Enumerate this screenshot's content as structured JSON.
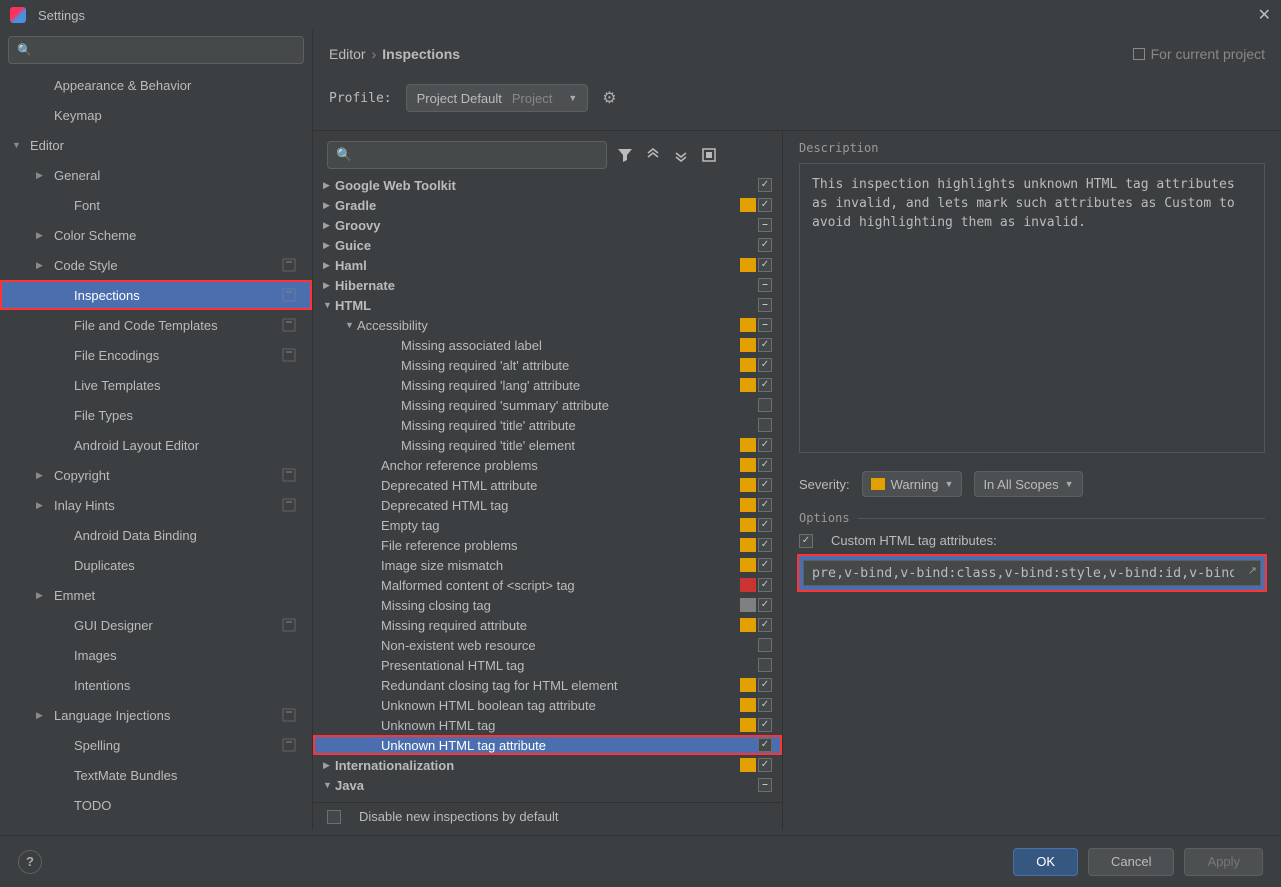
{
  "window_title": "Settings",
  "breadcrumb": {
    "a": "Editor",
    "b": "Inspections",
    "proj": "For current project"
  },
  "profile": {
    "label": "Profile:",
    "name": "Project Default",
    "scope": "Project"
  },
  "sidebar": {
    "items": [
      {
        "label": "Appearance & Behavior",
        "depth": 1,
        "arrow": false
      },
      {
        "label": "Keymap",
        "depth": 1,
        "arrow": false
      },
      {
        "label": "Editor",
        "depth": 0,
        "arrow": true,
        "open": true
      },
      {
        "label": "General",
        "depth": 1,
        "arrow": true
      },
      {
        "label": "Font",
        "depth": 2,
        "arrow": false
      },
      {
        "label": "Color Scheme",
        "depth": 1,
        "arrow": true
      },
      {
        "label": "Code Style",
        "depth": 1,
        "arrow": true,
        "proj": true
      },
      {
        "label": "Inspections",
        "depth": 2,
        "arrow": false,
        "selected": true,
        "proj": true,
        "hl": true
      },
      {
        "label": "File and Code Templates",
        "depth": 2,
        "arrow": false,
        "proj": true
      },
      {
        "label": "File Encodings",
        "depth": 2,
        "arrow": false,
        "proj": true
      },
      {
        "label": "Live Templates",
        "depth": 2,
        "arrow": false
      },
      {
        "label": "File Types",
        "depth": 2,
        "arrow": false
      },
      {
        "label": "Android Layout Editor",
        "depth": 2,
        "arrow": false
      },
      {
        "label": "Copyright",
        "depth": 1,
        "arrow": true,
        "proj": true
      },
      {
        "label": "Inlay Hints",
        "depth": 1,
        "arrow": true,
        "proj": true
      },
      {
        "label": "Android Data Binding",
        "depth": 2,
        "arrow": false
      },
      {
        "label": "Duplicates",
        "depth": 2,
        "arrow": false
      },
      {
        "label": "Emmet",
        "depth": 1,
        "arrow": true
      },
      {
        "label": "GUI Designer",
        "depth": 2,
        "arrow": false,
        "proj": true
      },
      {
        "label": "Images",
        "depth": 2,
        "arrow": false
      },
      {
        "label": "Intentions",
        "depth": 2,
        "arrow": false
      },
      {
        "label": "Language Injections",
        "depth": 1,
        "arrow": true,
        "proj": true
      },
      {
        "label": "Spelling",
        "depth": 2,
        "arrow": false,
        "proj": true
      },
      {
        "label": "TextMate Bundles",
        "depth": 2,
        "arrow": false
      },
      {
        "label": "TODO",
        "depth": 2,
        "arrow": false
      }
    ]
  },
  "tree": [
    {
      "label": "Google Web Toolkit",
      "depth": 0,
      "arrow": "r",
      "cb": "checked"
    },
    {
      "label": "Gradle",
      "depth": 0,
      "arrow": "r",
      "sev": "yellow",
      "cb": "checked"
    },
    {
      "label": "Groovy",
      "depth": 0,
      "arrow": "r",
      "cb": "mixed"
    },
    {
      "label": "Guice",
      "depth": 0,
      "arrow": "r",
      "cb": "checked"
    },
    {
      "label": "Haml",
      "depth": 0,
      "arrow": "r",
      "sev": "yellow",
      "cb": "checked"
    },
    {
      "label": "Hibernate",
      "depth": 0,
      "arrow": "r",
      "cb": "mixed"
    },
    {
      "label": "HTML",
      "depth": 0,
      "arrow": "d",
      "cb": "mixed"
    },
    {
      "label": "Accessibility",
      "depth": 1,
      "arrow": "d",
      "sev": "yellow",
      "cb": "mixed"
    },
    {
      "label": "Missing associated label",
      "depth": 3,
      "sev": "yellow",
      "cb": "checked"
    },
    {
      "label": "Missing required 'alt' attribute",
      "depth": 3,
      "sev": "yellow",
      "cb": "checked"
    },
    {
      "label": "Missing required 'lang' attribute",
      "depth": 3,
      "sev": "yellow",
      "cb": "checked"
    },
    {
      "label": "Missing required 'summary' attribute",
      "depth": 3,
      "cb": ""
    },
    {
      "label": "Missing required 'title' attribute",
      "depth": 3,
      "cb": ""
    },
    {
      "label": "Missing required 'title' element",
      "depth": 3,
      "sev": "yellow",
      "cb": "checked"
    },
    {
      "label": "Anchor reference problems",
      "depth": 2,
      "sev": "yellow",
      "cb": "checked"
    },
    {
      "label": "Deprecated HTML attribute",
      "depth": 2,
      "sev": "yellow",
      "cb": "checked"
    },
    {
      "label": "Deprecated HTML tag",
      "depth": 2,
      "sev": "yellow",
      "cb": "checked"
    },
    {
      "label": "Empty tag",
      "depth": 2,
      "sev": "yellow",
      "cb": "checked"
    },
    {
      "label": "File reference problems",
      "depth": 2,
      "sev": "yellow",
      "cb": "checked"
    },
    {
      "label": "Image size mismatch",
      "depth": 2,
      "sev": "yellow",
      "cb": "checked"
    },
    {
      "label": "Malformed content of <script> tag",
      "depth": 2,
      "sev": "red",
      "cb": "checked"
    },
    {
      "label": "Missing closing tag",
      "depth": 2,
      "sev": "gray",
      "cb": "checked"
    },
    {
      "label": "Missing required attribute",
      "depth": 2,
      "sev": "yellow",
      "cb": "checked"
    },
    {
      "label": "Non-existent web resource",
      "depth": 2,
      "cb": ""
    },
    {
      "label": "Presentational HTML tag",
      "depth": 2,
      "cb": ""
    },
    {
      "label": "Redundant closing tag for HTML element",
      "depth": 2,
      "sev": "yellow",
      "cb": "checked"
    },
    {
      "label": "Unknown HTML boolean tag attribute",
      "depth": 2,
      "sev": "yellow",
      "cb": "checked"
    },
    {
      "label": "Unknown HTML tag",
      "depth": 2,
      "sev": "yellow",
      "cb": "checked"
    },
    {
      "label": "Unknown HTML tag attribute",
      "depth": 2,
      "selected": true,
      "hl": true,
      "cb": "checked"
    },
    {
      "label": "Internationalization",
      "depth": 0,
      "arrow": "r",
      "sev": "yellow",
      "cb": "checked"
    },
    {
      "label": "Java",
      "depth": 0,
      "arrow": "d",
      "cb": "mixed"
    }
  ],
  "disable_new": "Disable new inspections by default",
  "right": {
    "desc_label": "Description",
    "desc_text": "This inspection highlights unknown HTML tag attributes as invalid, and lets mark such attributes as Custom to avoid highlighting them as invalid.",
    "sev_label": "Severity:",
    "sev_value": "Warning",
    "scope_value": "In All Scopes",
    "options_label": "Options",
    "custom_attr_label": "Custom HTML tag attributes:",
    "custom_attr_value": "pre,v-bind,v-bind:class,v-bind:style,v-bind:id,v-bind"
  },
  "footer": {
    "ok": "OK",
    "cancel": "Cancel",
    "apply": "Apply",
    "help": "?"
  }
}
